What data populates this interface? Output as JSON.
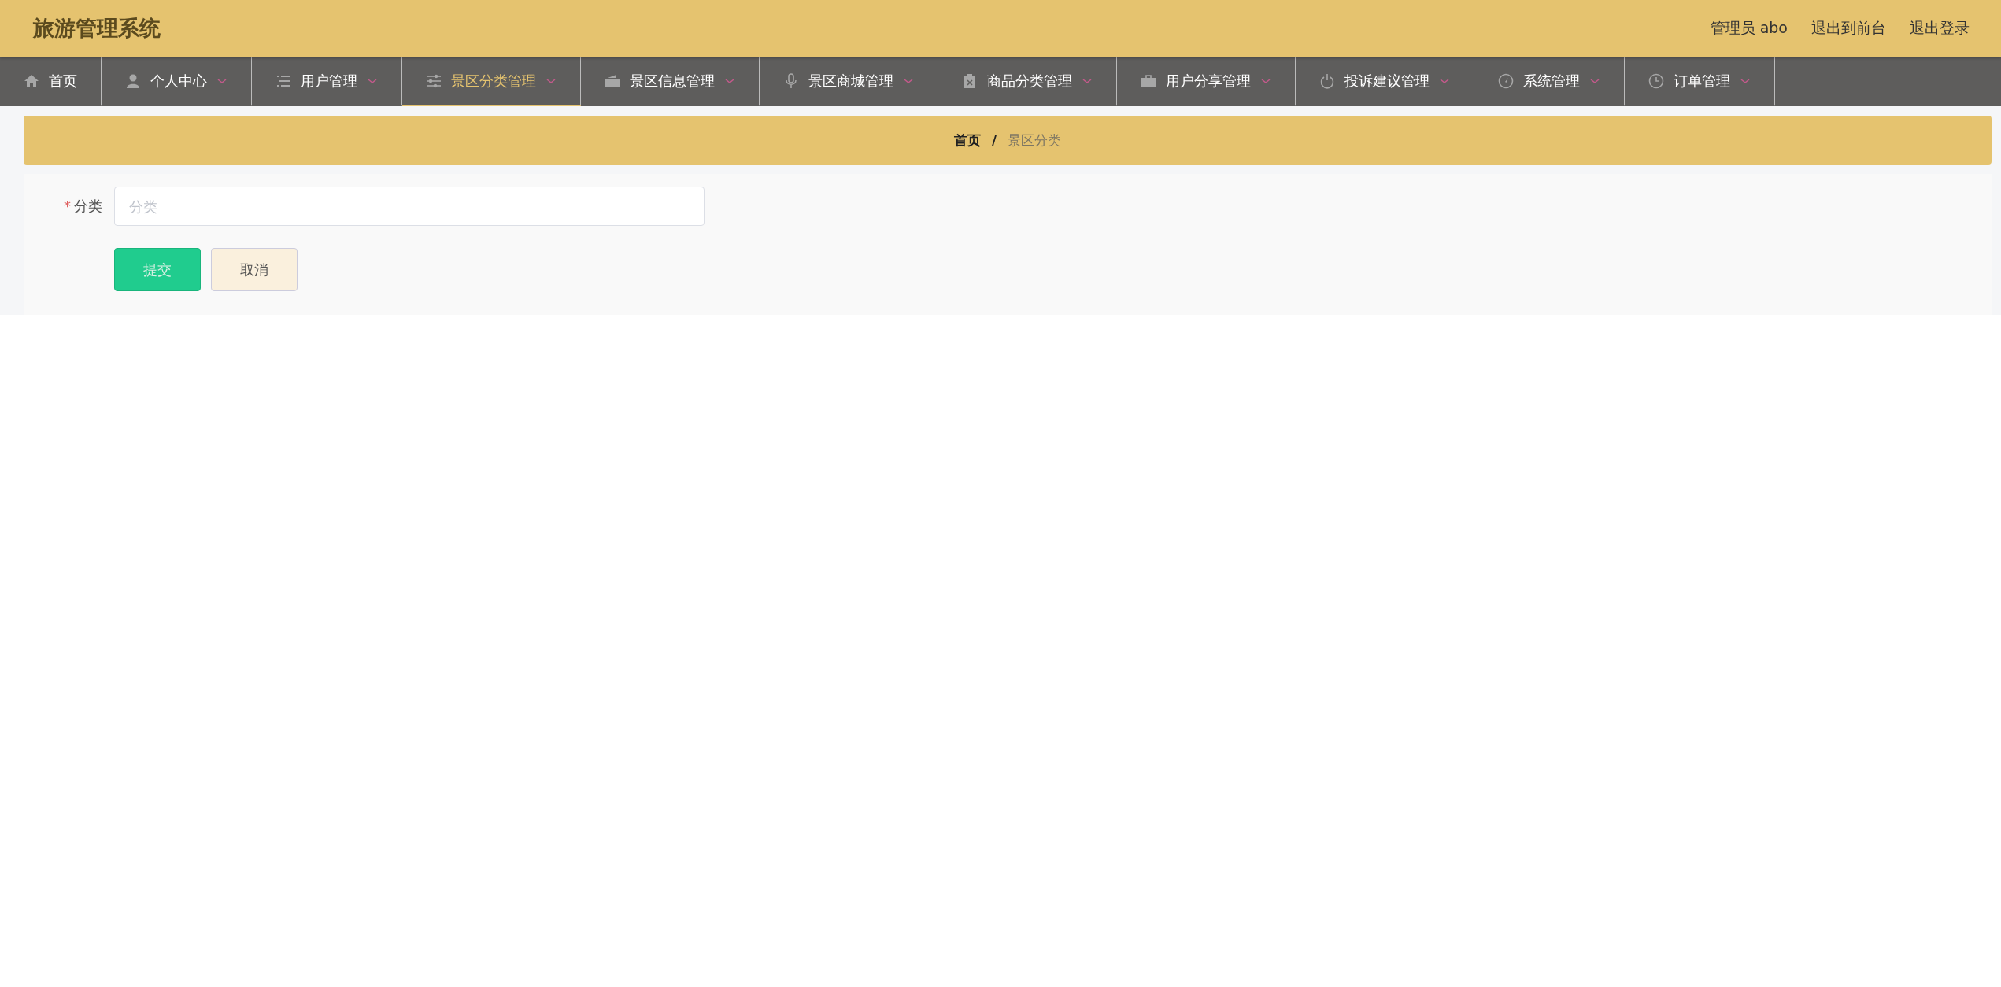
{
  "header": {
    "title": "旅游管理系统",
    "user": "管理员 abo",
    "links": [
      "退出到前台",
      "退出登录"
    ]
  },
  "nav": [
    {
      "label": "首页",
      "has_menu": false,
      "selected": false
    },
    {
      "label": "个人中心",
      "has_menu": true,
      "selected": false
    },
    {
      "label": "用户管理",
      "has_menu": true,
      "selected": false
    },
    {
      "label": "景区分类管理",
      "has_menu": true,
      "selected": true
    },
    {
      "label": "景区信息管理",
      "has_menu": true,
      "selected": false
    },
    {
      "label": "景区商城管理",
      "has_menu": true,
      "selected": false
    },
    {
      "label": "商品分类管理",
      "has_menu": true,
      "selected": false
    },
    {
      "label": "用户分享管理",
      "has_menu": true,
      "selected": false
    },
    {
      "label": "投诉建议管理",
      "has_menu": true,
      "selected": false
    },
    {
      "label": "系统管理",
      "has_menu": true,
      "selected": false
    },
    {
      "label": "订单管理",
      "has_menu": true,
      "selected": false
    }
  ],
  "breadcrumb": {
    "items": [
      "首页",
      "景区分类"
    ],
    "separator": "/"
  },
  "form": {
    "fields": [
      {
        "label": "分类",
        "required_mark": "*",
        "placeholder": "分类"
      }
    ],
    "buttons": [
      {
        "label": "提交",
        "kind": "primary"
      },
      {
        "label": "取消",
        "kind": "secondary"
      }
    ]
  }
}
